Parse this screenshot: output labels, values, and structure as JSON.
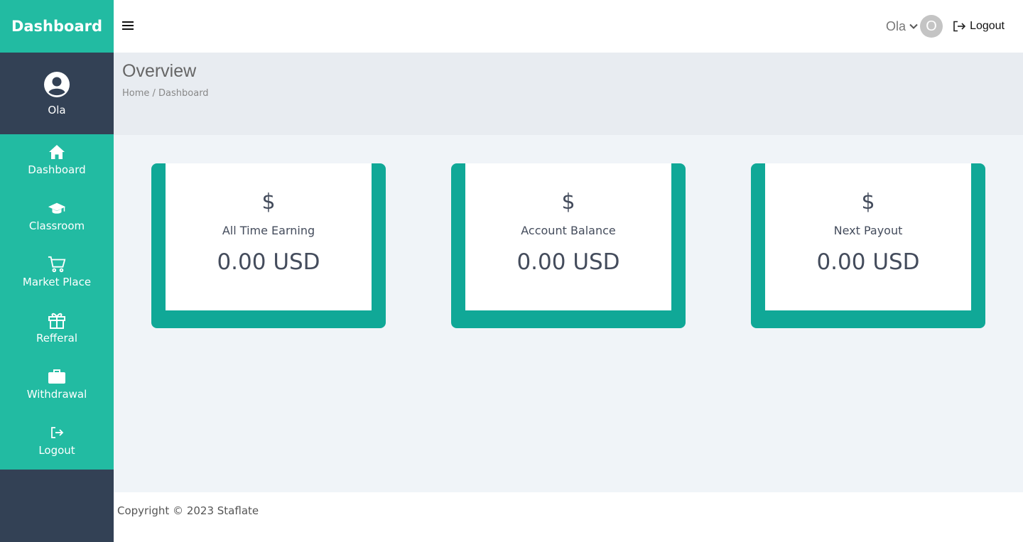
{
  "sidebar": {
    "brand": "Dashboard",
    "user": {
      "name": "Ola",
      "icon": "user-circle-icon"
    },
    "items": [
      {
        "label": "Dashboard",
        "icon": "home-icon"
      },
      {
        "label": "Classroom",
        "icon": "graduation-cap-icon"
      },
      {
        "label": "Market Place",
        "icon": "cart-icon"
      },
      {
        "label": "Refferal",
        "icon": "gift-icon"
      },
      {
        "label": "Withdrawal",
        "icon": "briefcase-icon"
      },
      {
        "label": "Logout",
        "icon": "logout-icon"
      }
    ]
  },
  "header": {
    "user_name": "Ola",
    "avatar_initial": "O",
    "logout_label": "Logout"
  },
  "overview": {
    "title": "Overview",
    "breadcrumb": "Home / Dashboard"
  },
  "cards": [
    {
      "symbol": "$",
      "title": "All Time Earning",
      "value": "0.00 USD"
    },
    {
      "symbol": "$",
      "title": "Account Balance",
      "value": "0.00 USD"
    },
    {
      "symbol": "$",
      "title": "Next Payout",
      "value": "0.00 USD"
    }
  ],
  "footer": {
    "copyright": "Copyright © 2023 Staflate"
  },
  "colors": {
    "accent": "#22bba2",
    "card_frame": "#10a897",
    "sidebar_dark": "#334155",
    "overview_bg": "#e8ecf1",
    "content_bg": "#f0f4f8"
  }
}
